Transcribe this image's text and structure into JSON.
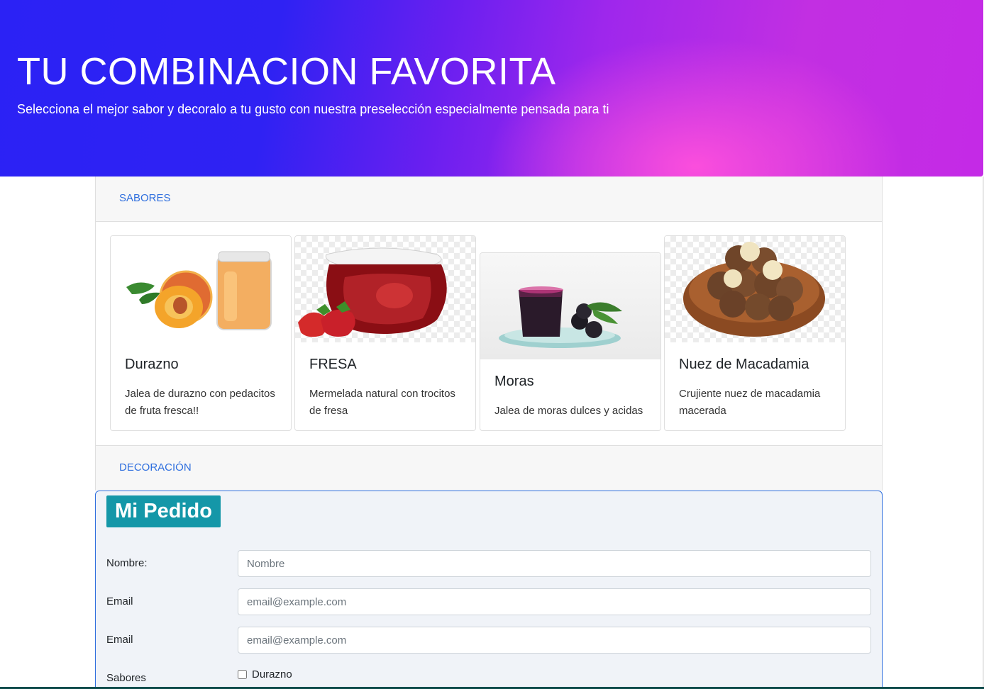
{
  "hero": {
    "title": "TU COMBINACION FAVORITA",
    "subtitle": "Selecciona el mejor sabor y decoralo a tu gusto con nuestra preselección especialmente pensada para ti"
  },
  "sections": {
    "sabores_label": "SABORES",
    "decoracion_label": "DECORACIÓN"
  },
  "cards": [
    {
      "title": "Durazno",
      "text": "Jalea de durazno con pedacitos de fruta fresca!!",
      "image": "peach-jam-image"
    },
    {
      "title": "FRESA",
      "text": "Mermelada natural con trocitos de fresa",
      "image": "strawberry-jam-image"
    },
    {
      "title": "Moras",
      "text": "Jalea de moras dulces y acidas",
      "image": "blackberry-jelly-image"
    },
    {
      "title": "Nuez de Macadamia",
      "text": "Crujiente nuez de macadamia macerada",
      "image": "macadamia-bowl-image"
    }
  ],
  "order": {
    "title": "Mi Pedido",
    "nombre_label": "Nombre:",
    "nombre_placeholder": "Nombre",
    "email_label": "Email",
    "email_placeholder": "email@example.com",
    "email2_label": "Email",
    "email2_placeholder": "email@example.com",
    "sabores_label": "Sabores",
    "sabores_options": [
      "Durazno"
    ]
  },
  "colors": {
    "accent_link": "#2f6fde",
    "order_title_bg": "#1497a8",
    "hero_start": "#2b22f5",
    "hero_end": "#c42ae6"
  }
}
